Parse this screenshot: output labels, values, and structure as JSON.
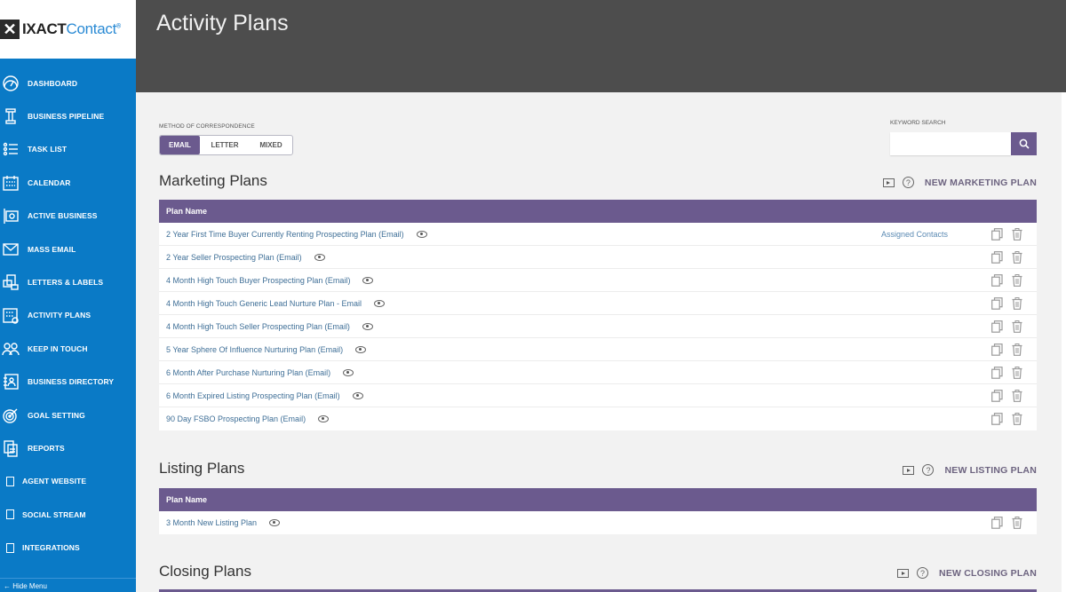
{
  "app": {
    "logo_prefix": "IXACT",
    "logo_suffix": "Contact",
    "logo_mark": "®"
  },
  "header": {
    "title": "Activity Plans"
  },
  "sidebar": {
    "items": [
      {
        "label": "DASHBOARD",
        "icon": "dashboard-icon"
      },
      {
        "label": "BUSINESS PIPELINE",
        "icon": "pipeline-icon"
      },
      {
        "label": "TASK LIST",
        "icon": "task-list-icon"
      },
      {
        "label": "CALENDAR",
        "icon": "calendar-icon"
      },
      {
        "label": "ACTIVE BUSINESS",
        "icon": "active-business-icon"
      },
      {
        "label": "MASS EMAIL",
        "icon": "envelope-icon"
      },
      {
        "label": "LETTERS & LABELS",
        "icon": "letters-icon"
      },
      {
        "label": "ACTIVITY PLANS",
        "icon": "activity-plans-icon"
      },
      {
        "label": "KEEP IN TOUCH",
        "icon": "people-icon"
      },
      {
        "label": "BUSINESS DIRECTORY",
        "icon": "directory-icon"
      },
      {
        "label": "GOAL SETTING",
        "icon": "target-icon"
      },
      {
        "label": "REPORTS",
        "icon": "reports-icon"
      },
      {
        "label": "AGENT WEBSITE",
        "icon": "placeholder-icon"
      },
      {
        "label": "SOCIAL STREAM",
        "icon": "placeholder-icon"
      },
      {
        "label": "INTEGRATIONS",
        "icon": "placeholder-icon"
      }
    ],
    "hide_menu": "← Hide Menu"
  },
  "filters": {
    "method_label": "METHOD OF CORRESPONDENCE",
    "options": [
      "EMAIL",
      "LETTER",
      "MIXED"
    ],
    "selected": "EMAIL",
    "keyword_label": "KEYWORD SEARCH",
    "keyword_value": "",
    "keyword_placeholder": ""
  },
  "sections": {
    "marketing": {
      "title": "Marketing Plans",
      "new_label": "NEW MARKETING PLAN",
      "column": "Plan Name",
      "rows": [
        {
          "name": "2 Year First Time Buyer Currently Renting Prospecting Plan (Email)",
          "assigned": "Assigned Contacts"
        },
        {
          "name": "2 Year Seller Prospecting Plan (Email)",
          "assigned": ""
        },
        {
          "name": "4 Month High Touch Buyer Prospecting Plan (Email)",
          "assigned": ""
        },
        {
          "name": "4 Month High Touch Generic Lead Nurture Plan - Email",
          "assigned": ""
        },
        {
          "name": "4 Month High Touch Seller Prospecting Plan (Email)",
          "assigned": ""
        },
        {
          "name": "5 Year Sphere Of Influence Nurturing Plan (Email)",
          "assigned": ""
        },
        {
          "name": "6 Month After Purchase Nurturing Plan (Email)",
          "assigned": ""
        },
        {
          "name": "6 Month Expired Listing Prospecting Plan (Email)",
          "assigned": ""
        },
        {
          "name": "90 Day FSBO Prospecting Plan (Email)",
          "assigned": ""
        }
      ]
    },
    "listing": {
      "title": "Listing Plans",
      "new_label": "NEW LISTING PLAN",
      "column": "Plan Name",
      "rows": [
        {
          "name": "3 Month New Listing Plan",
          "assigned": ""
        }
      ]
    },
    "closing": {
      "title": "Closing Plans",
      "new_label": "NEW CLOSING PLAN"
    }
  },
  "colors": {
    "sidebar": "#0a7ac6",
    "accent": "#6b5a8e",
    "topbar": "#4d4d4d",
    "link": "#3f6f97"
  }
}
